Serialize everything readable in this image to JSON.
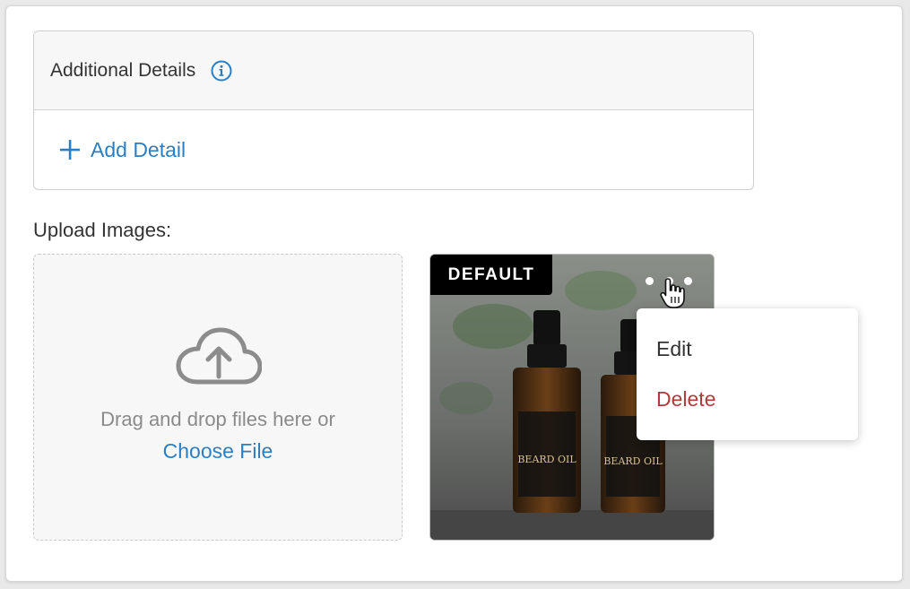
{
  "additional_details": {
    "title": "Additional Details",
    "add_label": "Add Detail"
  },
  "upload": {
    "label": "Upload Images:",
    "drop_text": "Drag and drop files here or",
    "choose_file": "Choose File"
  },
  "image_card": {
    "badge": "DEFAULT"
  },
  "menu": {
    "items": [
      {
        "label": "Edit"
      },
      {
        "label": "Delete"
      }
    ]
  },
  "colors": {
    "accent": "#2c7ec2",
    "danger": "#b33a3a",
    "text": "#333333"
  }
}
